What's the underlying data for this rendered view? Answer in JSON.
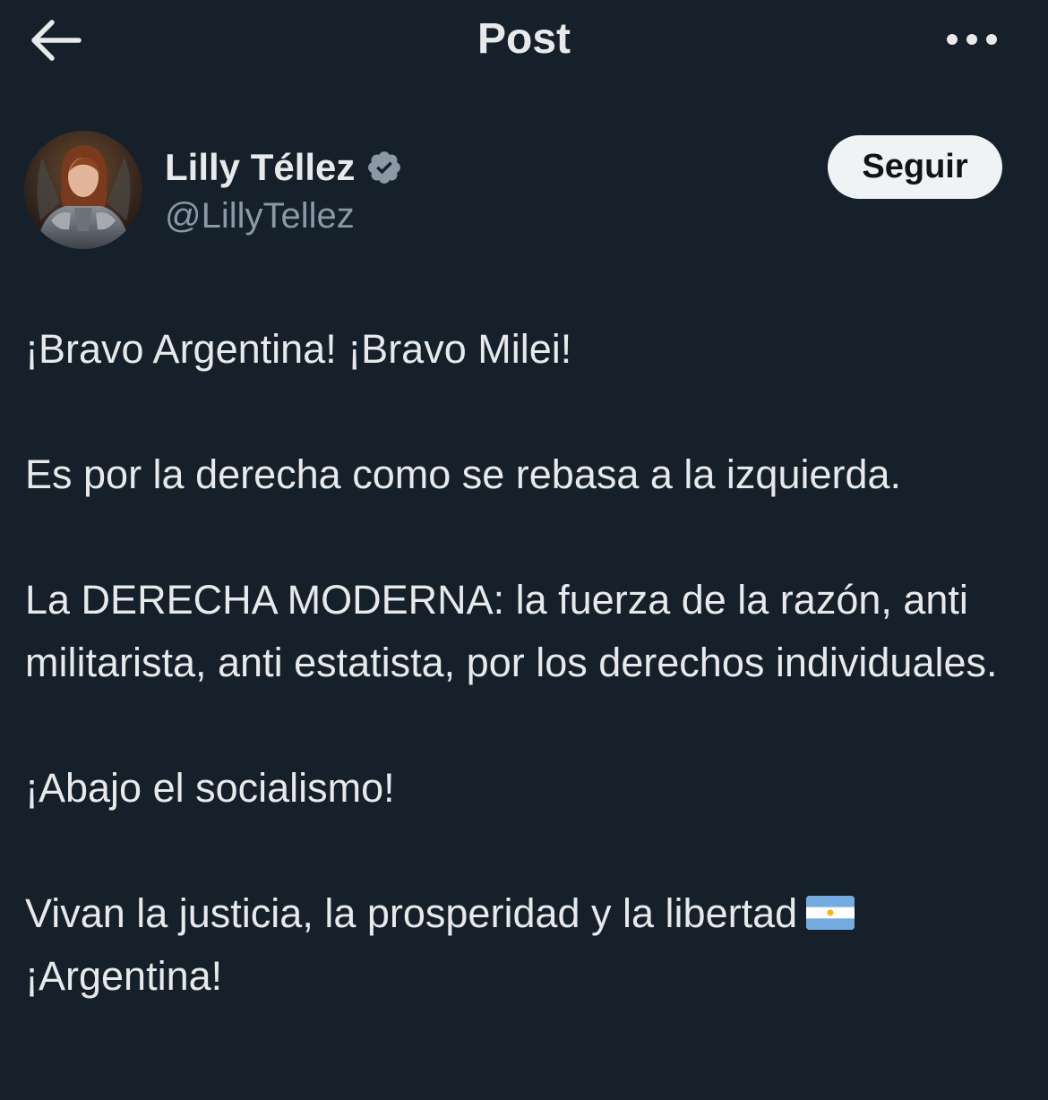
{
  "header": {
    "title": "Post",
    "back_icon": "arrow-left-icon",
    "more_icon": "more-horizontal-icon"
  },
  "author": {
    "display_name": "Lilly Téllez",
    "handle": "@LillyTellez",
    "verified_icon": "verified-badge-icon",
    "follow_label": "Seguir"
  },
  "post": {
    "paragraphs": [
      "¡Bravo Argentina! ¡Bravo Milei!",
      "Es por la derecha como se rebasa a la izquierda.",
      "La DERECHA MODERNA: la fuerza de la razón, anti militarista, anti estatista, por los derechos individuales.",
      "¡Abajo el socialismo!"
    ],
    "last_paragraph_line1": "Vivan la justicia, la prosperidad y la libertad",
    "last_paragraph_line2": "¡Argentina!",
    "flag_icon": "argentina-flag-icon"
  },
  "colors": {
    "background": "#15202b",
    "text": "#e7e9ea",
    "secondary_text": "#8b98a5",
    "verified": "#8b98a5",
    "follow_bg": "#eff3f4"
  }
}
